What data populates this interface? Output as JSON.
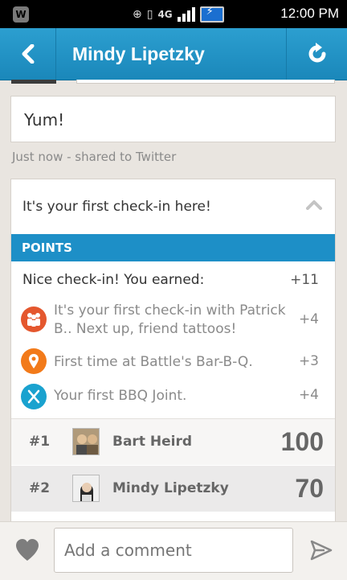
{
  "status_bar": {
    "network": "4G",
    "time": "12:00 PM"
  },
  "header": {
    "title": "Mindy Lipetzky",
    "back_icon": "chevron-left-icon",
    "refresh_icon": "refresh-icon"
  },
  "comment": {
    "text": "Yum!",
    "meta": "Just now - shared to Twitter"
  },
  "checkin": {
    "first_checkin_text": "It's your first check-in here!",
    "points_header": "POINTS",
    "earned_label": "Nice check-in! You earned:",
    "earned_total": "+11",
    "rewards": [
      {
        "icon": "friends-icon",
        "color": "#e4572e",
        "text": "It's your first check-in with Patrick B.. Next up, friend tattoos!",
        "points": "+4"
      },
      {
        "icon": "location-pin-icon",
        "color": "#f27a1a",
        "text": "First time at Battle's Bar-B-Q.",
        "points": "+3"
      },
      {
        "icon": "fork-knife-icon",
        "color": "#1aa2cf",
        "text": "Your first BBQ Joint.",
        "points": "+4"
      }
    ],
    "leaderboard": [
      {
        "rank": "#1",
        "name": "Bart Heird",
        "score": "100"
      },
      {
        "rank": "#2",
        "name": "Mindy Lipetzky",
        "score": "70"
      }
    ]
  },
  "composer": {
    "placeholder": "Add a comment"
  },
  "colors": {
    "action_bar": "#1d8fc7",
    "points_bar": "#1d8fc7",
    "background": "#e9e5e0"
  }
}
